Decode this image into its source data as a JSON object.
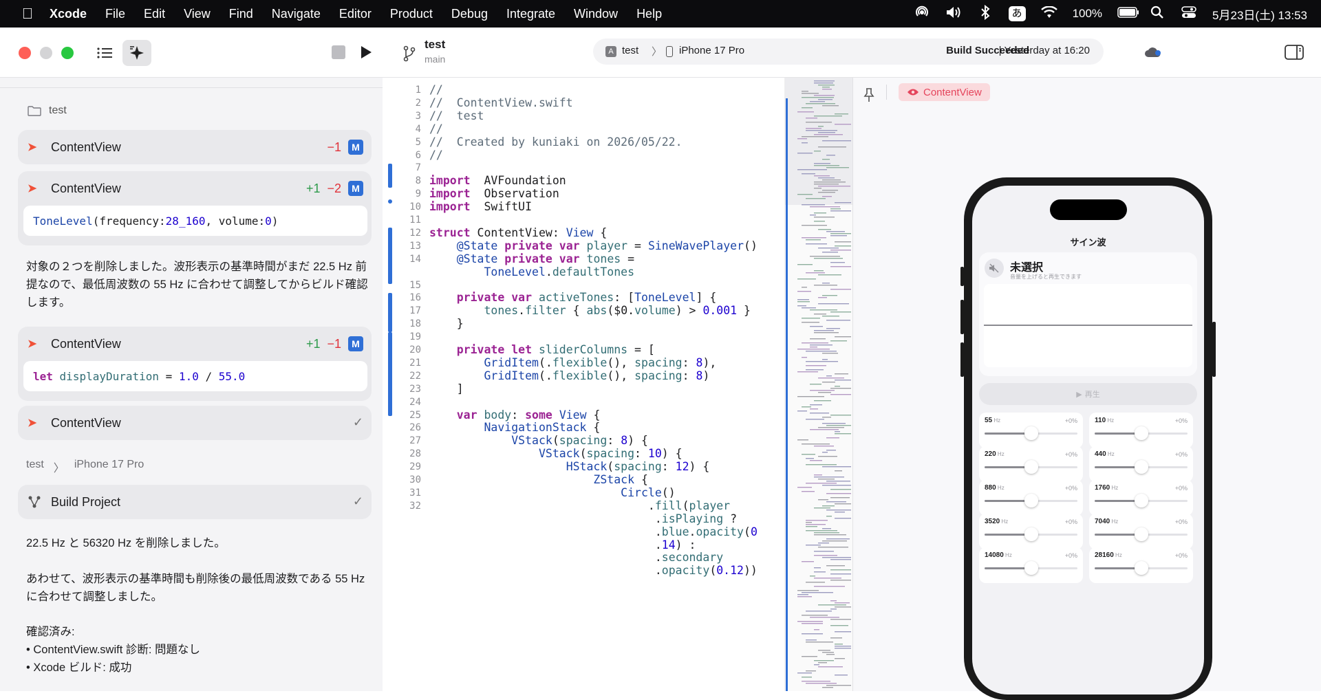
{
  "menubar": {
    "app": "Xcode",
    "items": [
      "File",
      "Edit",
      "View",
      "Find",
      "Navigate",
      "Editor",
      "Product",
      "Debug",
      "Integrate",
      "Window",
      "Help"
    ],
    "input_mode": "あ",
    "battery": "100%",
    "clock": "5月23日(土) 13:53"
  },
  "toolbar": {
    "project": "test",
    "branch": "main",
    "scheme": "test",
    "device": "iPhone 17 Pro",
    "status_bold": "Build Succeeded",
    "status_rest": "| Yesterday at 16:20"
  },
  "sidebar": {
    "folder": "test",
    "card1": {
      "title": "ContentView",
      "minus": "−1",
      "badge": "M"
    },
    "card2": {
      "title": "ContentView",
      "plus": "+1",
      "minus": "−2",
      "badge": "M",
      "code_fn": "ToneLevel",
      "code_a": "(frequency: ",
      "code_n1": "28_160",
      "code_b": ", volume: ",
      "code_n2": "0",
      "code_c": ")"
    },
    "para1": "対象の２つを削除しました。波形表示の基準時間がまだ 22.5 Hz 前提なので、最低周波数の 55 Hz に合わせて調整してからビルド確認します。",
    "card3": {
      "title": "ContentView",
      "plus": "+1",
      "minus": "−1",
      "badge": "M",
      "code_kw": "let",
      "code_name": "displayDuration",
      "code_eq": " = ",
      "code_n1": "1.0",
      "code_div": " / ",
      "code_n2": "55.0"
    },
    "card4": {
      "title": "ContentView",
      "check": "✓"
    },
    "breadcrumb_project": "test",
    "breadcrumb_sep": "〉",
    "breadcrumb_device": "iPhone 17 Pro",
    "card5": {
      "title": "Build Project",
      "check": "✓"
    },
    "para2": "22.5 Hz と 56320 Hz を削除しました。",
    "para3": "あわせて、波形表示の基準時間も削除後の最低周波数である 55 Hz に合わせて調整しました。",
    "para4": "確認済み:",
    "bullet1": "• ContentView.swift 診断: 問題なし",
    "bullet2": "• Xcode ビルド: 成功"
  },
  "editor": {
    "lines": [
      {
        "n": "1",
        "html": [
          [
            "cm",
            "//"
          ]
        ]
      },
      {
        "n": "2",
        "html": [
          [
            "cm",
            "//  ContentView.swift"
          ]
        ]
      },
      {
        "n": "3",
        "html": [
          [
            "cm",
            "//  test"
          ]
        ]
      },
      {
        "n": "4",
        "html": [
          [
            "cm",
            "//"
          ]
        ]
      },
      {
        "n": "5",
        "html": [
          [
            "cm",
            "//  Created by kuniaki on 2026/05/22."
          ]
        ]
      },
      {
        "n": "6",
        "html": [
          [
            "cm",
            "//"
          ]
        ]
      },
      {
        "n": "7",
        "html": []
      },
      {
        "n": "8",
        "html": [
          [
            "kw",
            "import"
          ],
          [
            "",
            "  AVFoundation"
          ]
        ]
      },
      {
        "n": "9",
        "html": [
          [
            "kw",
            "import"
          ],
          [
            "",
            "  Observation"
          ]
        ]
      },
      {
        "n": "10",
        "html": [
          [
            "kw",
            "import"
          ],
          [
            "",
            "  SwiftUI"
          ]
        ]
      },
      {
        "n": "11",
        "html": []
      },
      {
        "n": "12",
        "html": [
          [
            "kw",
            "struct"
          ],
          [
            "",
            " ContentView: "
          ],
          [
            "ty",
            "View"
          ],
          [
            "",
            " {"
          ]
        ]
      },
      {
        "n": "13",
        "html": [
          [
            "",
            "    "
          ],
          [
            "ty",
            "@State"
          ],
          [
            "",
            " "
          ],
          [
            "kw",
            "private var"
          ],
          [
            "",
            " "
          ],
          [
            "fn",
            "player"
          ],
          [
            "",
            " = "
          ],
          [
            "ty",
            "SineWavePlayer"
          ],
          [
            "",
            "()"
          ]
        ]
      },
      {
        "n": "14",
        "html": [
          [
            "",
            "    "
          ],
          [
            "ty",
            "@State"
          ],
          [
            "",
            " "
          ],
          [
            "kw",
            "private var"
          ],
          [
            "",
            " "
          ],
          [
            "fn",
            "tones"
          ],
          [
            "",
            " ="
          ]
        ]
      },
      {
        "n": "",
        "html": [
          [
            "",
            "        "
          ],
          [
            "ty",
            "ToneLevel"
          ],
          [
            "",
            "."
          ],
          [
            "fn",
            "defaultTones"
          ]
        ]
      },
      {
        "n": "15",
        "html": []
      },
      {
        "n": "16",
        "html": [
          [
            "",
            "    "
          ],
          [
            "kw",
            "private var"
          ],
          [
            "",
            " "
          ],
          [
            "fn",
            "activeTones"
          ],
          [
            "",
            ": ["
          ],
          [
            "ty",
            "ToneLevel"
          ],
          [
            "",
            "] {"
          ]
        ]
      },
      {
        "n": "17",
        "html": [
          [
            "",
            "        "
          ],
          [
            "fn",
            "tones"
          ],
          [
            "",
            "."
          ],
          [
            "fn",
            "filter"
          ],
          [
            "",
            " { "
          ],
          [
            "fn",
            "abs"
          ],
          [
            "",
            "($0."
          ],
          [
            "fn",
            "volume"
          ],
          [
            "",
            ") > "
          ],
          [
            "nm",
            "0.001"
          ],
          [
            "",
            " }"
          ]
        ]
      },
      {
        "n": "18",
        "html": [
          [
            "",
            "    }"
          ]
        ]
      },
      {
        "n": "19",
        "html": []
      },
      {
        "n": "20",
        "html": [
          [
            "",
            "    "
          ],
          [
            "kw",
            "private let"
          ],
          [
            "",
            " "
          ],
          [
            "fn",
            "sliderColumns"
          ],
          [
            "",
            " = ["
          ]
        ]
      },
      {
        "n": "21",
        "html": [
          [
            "",
            "        "
          ],
          [
            "ty",
            "GridItem"
          ],
          [
            "",
            "(."
          ],
          [
            "fn",
            "flexible"
          ],
          [
            "",
            "(), "
          ],
          [
            "fn",
            "spacing"
          ],
          [
            "",
            ": "
          ],
          [
            "nm",
            "8"
          ],
          [
            "",
            "),"
          ]
        ]
      },
      {
        "n": "22",
        "html": [
          [
            "",
            "        "
          ],
          [
            "ty",
            "GridItem"
          ],
          [
            "",
            "(."
          ],
          [
            "fn",
            "flexible"
          ],
          [
            "",
            "(), "
          ],
          [
            "fn",
            "spacing"
          ],
          [
            "",
            ": "
          ],
          [
            "nm",
            "8"
          ],
          [
            "",
            ")"
          ]
        ]
      },
      {
        "n": "23",
        "html": [
          [
            "",
            "    ]"
          ]
        ]
      },
      {
        "n": "24",
        "html": []
      },
      {
        "n": "25",
        "html": [
          [
            "",
            "    "
          ],
          [
            "kw",
            "var"
          ],
          [
            "",
            " "
          ],
          [
            "fn",
            "body"
          ],
          [
            "",
            ": "
          ],
          [
            "kw",
            "some"
          ],
          [
            "",
            " "
          ],
          [
            "ty",
            "View"
          ],
          [
            "",
            " {"
          ]
        ]
      },
      {
        "n": "26",
        "html": [
          [
            "",
            "        "
          ],
          [
            "ty",
            "NavigationStack"
          ],
          [
            "",
            " {"
          ]
        ]
      },
      {
        "n": "27",
        "html": [
          [
            "",
            "            "
          ],
          [
            "ty",
            "VStack"
          ],
          [
            "",
            "("
          ],
          [
            "fn",
            "spacing"
          ],
          [
            "",
            ": "
          ],
          [
            "nm",
            "8"
          ],
          [
            "",
            ") {"
          ]
        ]
      },
      {
        "n": "28",
        "html": [
          [
            "",
            "                "
          ],
          [
            "ty",
            "VStack"
          ],
          [
            "",
            "("
          ],
          [
            "fn",
            "spacing"
          ],
          [
            "",
            ": "
          ],
          [
            "nm",
            "10"
          ],
          [
            "",
            ") {"
          ]
        ]
      },
      {
        "n": "29",
        "html": [
          [
            "",
            "                    "
          ],
          [
            "ty",
            "HStack"
          ],
          [
            "",
            "("
          ],
          [
            "fn",
            "spacing"
          ],
          [
            "",
            ": "
          ],
          [
            "nm",
            "12"
          ],
          [
            "",
            ") {"
          ]
        ]
      },
      {
        "n": "30",
        "html": [
          [
            "",
            "                        "
          ],
          [
            "ty",
            "ZStack"
          ],
          [
            "",
            " {"
          ]
        ]
      },
      {
        "n": "31",
        "html": [
          [
            "",
            "                            "
          ],
          [
            "ty",
            "Circle"
          ],
          [
            "",
            "()"
          ]
        ]
      },
      {
        "n": "32",
        "html": [
          [
            "",
            "                                ."
          ],
          [
            "fn",
            "fill"
          ],
          [
            "",
            "("
          ],
          [
            "fn",
            "player"
          ]
        ]
      },
      {
        "n": "",
        "html": [
          [
            "",
            "                                 ."
          ],
          [
            "fn",
            "isPlaying"
          ],
          [
            "",
            " ?"
          ]
        ]
      },
      {
        "n": "",
        "html": [
          [
            "",
            "                                 ."
          ],
          [
            "fn",
            "blue"
          ],
          [
            "",
            "."
          ],
          [
            "fn",
            "opacity"
          ],
          [
            "",
            "("
          ],
          [
            "nm",
            "0"
          ]
        ]
      },
      {
        "n": "",
        "html": [
          [
            "",
            "                                 ."
          ],
          [
            "nm",
            "14"
          ],
          [
            "",
            ") :"
          ]
        ]
      },
      {
        "n": "",
        "html": [
          [
            "",
            "                                 ."
          ],
          [
            "fn",
            "secondary"
          ]
        ]
      },
      {
        "n": "",
        "html": [
          [
            "",
            "                                 ."
          ],
          [
            "fn",
            "opacity"
          ],
          [
            "",
            "("
          ],
          [
            "nm",
            "0.12"
          ],
          [
            "",
            "))"
          ]
        ]
      }
    ]
  },
  "preview": {
    "tag": "ContentView",
    "app_title": "サイン波",
    "state_title": "未選択",
    "state_sub": "音量を上げると再生できます",
    "play": "再生",
    "tones": [
      {
        "hz": "55",
        "unit": "Hz",
        "pct": "+0%",
        "level": 0.5
      },
      {
        "hz": "110",
        "unit": "Hz",
        "pct": "+0%",
        "level": 0.5
      },
      {
        "hz": "220",
        "unit": "Hz",
        "pct": "+0%",
        "level": 0.5
      },
      {
        "hz": "440",
        "unit": "Hz",
        "pct": "+0%",
        "level": 0.5
      },
      {
        "hz": "880",
        "unit": "Hz",
        "pct": "+0%",
        "level": 0.5
      },
      {
        "hz": "1760",
        "unit": "Hz",
        "pct": "+0%",
        "level": 0.5
      },
      {
        "hz": "3520",
        "unit": "Hz",
        "pct": "+0%",
        "level": 0.5
      },
      {
        "hz": "7040",
        "unit": "Hz",
        "pct": "+0%",
        "level": 0.5
      },
      {
        "hz": "14080",
        "unit": "Hz",
        "pct": "+0%",
        "level": 0.5
      },
      {
        "hz": "28160",
        "unit": "Hz",
        "pct": "+0%",
        "level": 0.5
      }
    ]
  }
}
